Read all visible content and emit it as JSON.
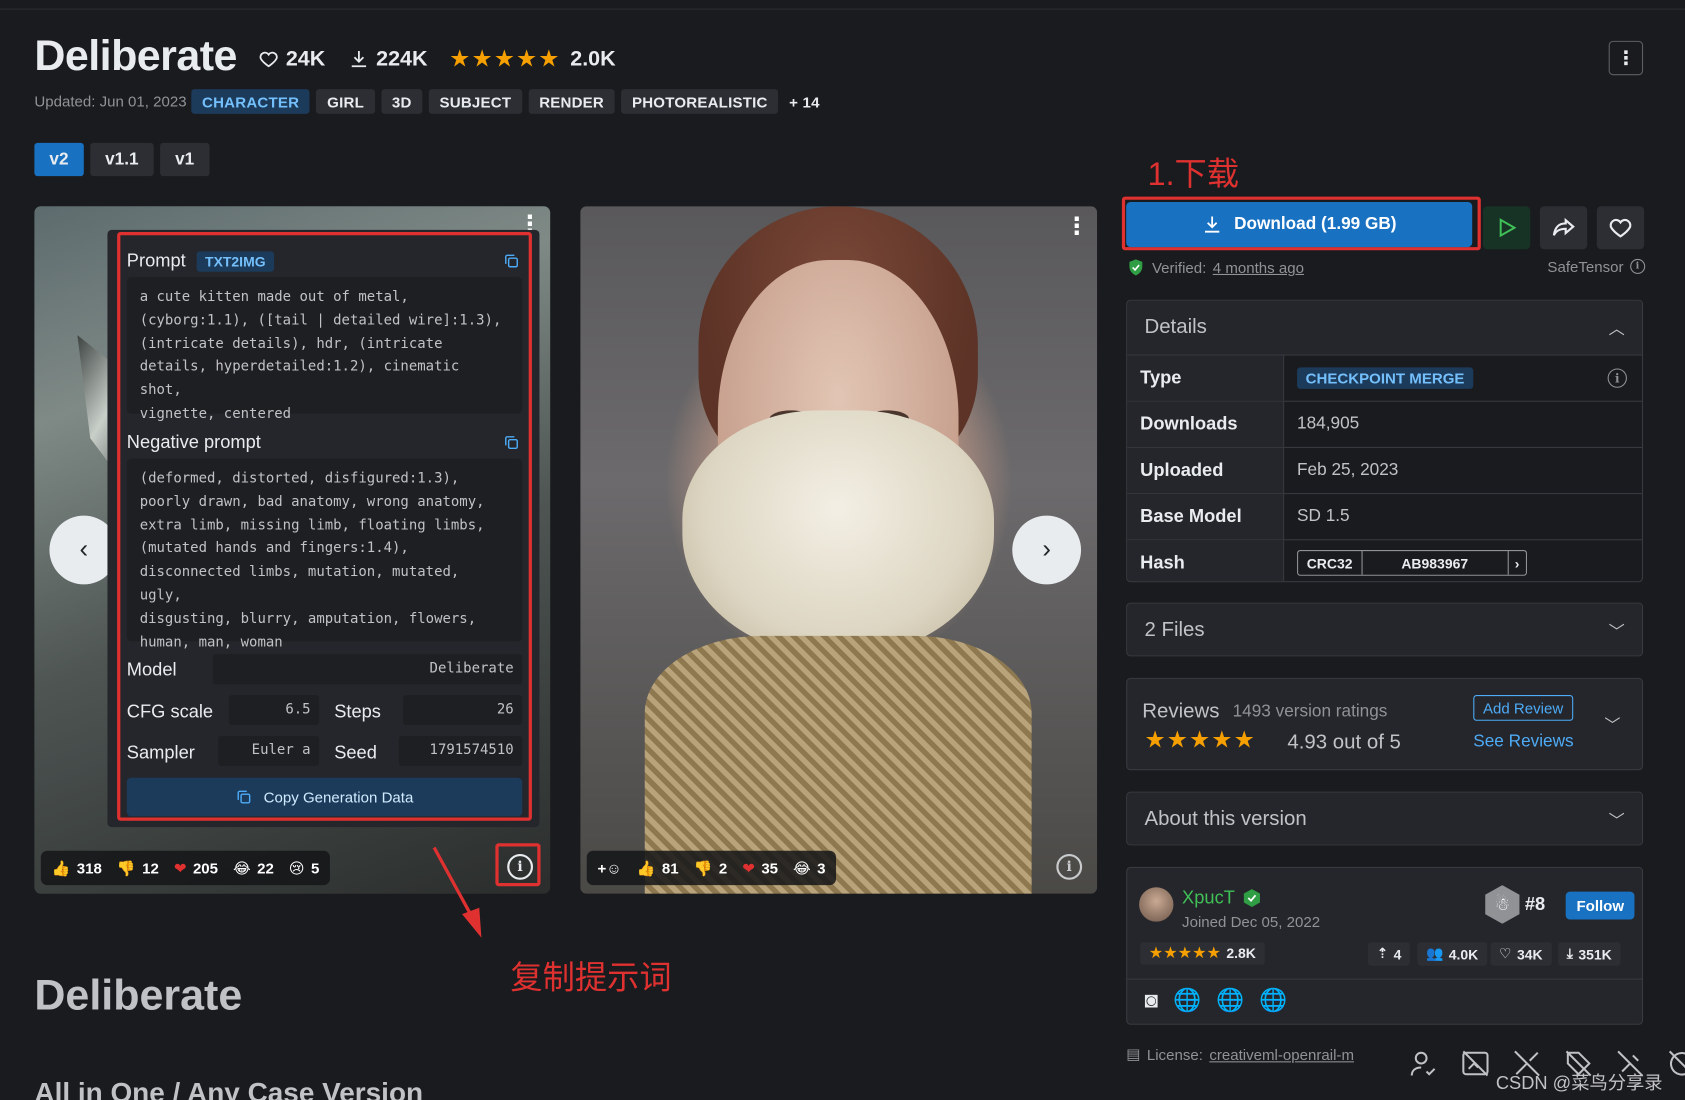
{
  "model": {
    "title": "Deliberate",
    "likes": "24K",
    "downloads": "224K",
    "rating_count": "2.0K",
    "updated": "Updated: Jun 01, 2023",
    "tags": [
      "CHARACTER",
      "GIRL",
      "3D",
      "SUBJECT",
      "RENDER",
      "PHOTOREALISTIC"
    ],
    "tags_more": "+ 14",
    "versions": [
      "v2",
      "v1.1",
      "v1"
    ]
  },
  "generation": {
    "prompt_label": "Prompt",
    "prompt_mode": "TXT2IMG",
    "prompt_text": "a cute kitten made out of metal,\n(cyborg:1.1), ([tail | detailed wire]:1.3),\n(intricate details), hdr, (intricate\ndetails, hyperdetailed:1.2), cinematic shot,\nvignette, centered",
    "negative_label": "Negative prompt",
    "negative_text": "(deformed, distorted, disfigured:1.3),\npoorly drawn, bad anatomy, wrong anatomy,\nextra limb, missing limb, floating limbs,\n(mutated hands and fingers:1.4),\ndisconnected limbs, mutation, mutated, ugly,\ndisgusting, blurry, amputation, flowers,\nhuman, man, woman",
    "model_label": "Model",
    "model_value": "Deliberate",
    "cfg_label": "CFG scale",
    "cfg_value": "6.5",
    "steps_label": "Steps",
    "steps_value": "26",
    "sampler_label": "Sampler",
    "sampler_value": "Euler a",
    "seed_label": "Seed",
    "seed_value": "1791574510",
    "copy_button": "Copy Generation Data"
  },
  "image1_reactions": [
    {
      "icon": "thumbs-up-icon",
      "glyph": "👍",
      "count": "318"
    },
    {
      "icon": "thumbs-down-icon",
      "glyph": "👎",
      "count": "12"
    },
    {
      "icon": "heart-icon",
      "glyph": "❤️",
      "count": "205"
    },
    {
      "icon": "laugh-icon",
      "glyph": "😂",
      "count": "22"
    },
    {
      "icon": "cry-icon",
      "glyph": "😢",
      "count": "5"
    }
  ],
  "image2_reactions": [
    {
      "icon": "thumbs-up-icon",
      "glyph": "👍",
      "count": "81"
    },
    {
      "icon": "thumbs-down-icon",
      "glyph": "👎",
      "count": "2"
    },
    {
      "icon": "heart-icon",
      "glyph": "❤️",
      "count": "35"
    },
    {
      "icon": "laugh-icon",
      "glyph": "😂",
      "count": "3"
    }
  ],
  "annotations": {
    "download_note": "1.下载",
    "copy_note": "复制提示词"
  },
  "sidebar": {
    "download_label": "Download (1.99 GB)",
    "verified_label": "Verified:",
    "verified_time": "4 months ago",
    "safetensor": "SafeTensor",
    "details_title": "Details",
    "details": [
      {
        "key": "Type",
        "value": "CHECKPOINT MERGE"
      },
      {
        "key": "Downloads",
        "value": "184,905"
      },
      {
        "key": "Uploaded",
        "value": "Feb 25, 2023"
      },
      {
        "key": "Base Model",
        "value": "SD 1.5"
      },
      {
        "key": "Hash",
        "value": "AB983967"
      }
    ],
    "hash_type": "CRC32",
    "files_title": "2 Files",
    "reviews_title": "Reviews",
    "reviews_count": "1493 version ratings",
    "reviews_score": "4.93 out of 5",
    "add_review": "Add Review",
    "see_reviews": "See Reviews",
    "about_title": "About this version",
    "creator": {
      "name": "XpucT",
      "joined": "Joined Dec 05, 2022",
      "rank": "#8",
      "follow": "Follow",
      "rating_count": "2.8K",
      "uploads": "4",
      "followers": "4.0K",
      "likes": "34K",
      "downloads": "351K"
    },
    "license_label": "License:",
    "license_value": "creativeml-openrail-m"
  },
  "page": {
    "heading": "Deliberate",
    "subheading": "All in One / Any Case Version"
  },
  "watermark": "CSDN @菜鸟分享录",
  "colors": {
    "accent": "#1971c2",
    "tag_blue": "#74c0fc",
    "star": "#f59f00",
    "annotation_red": "#e03131",
    "green_verified": "#37b24d"
  }
}
